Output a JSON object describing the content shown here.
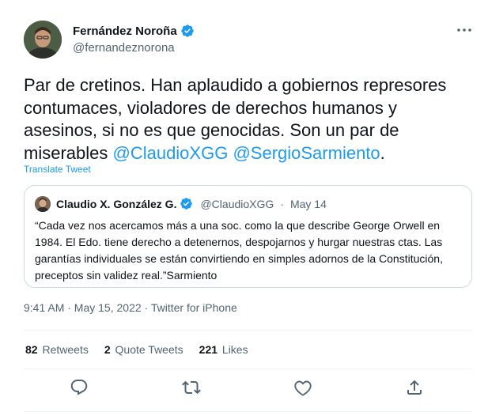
{
  "tweet": {
    "author": {
      "name": "Fernández Noroña",
      "handle": "@fernandeznorona",
      "verified": true
    },
    "text": {
      "body": "Par de cretinos. Han aplaudido a gobiernos represores contumaces, violadores de derechos humanos y asesinos, si no es que genocidas. Son un par de miserables ",
      "mention1": "@ClaudioXGG",
      "space": " ",
      "mention2": "@SergioSarmiento",
      "end": "."
    },
    "translate_label": "Translate Tweet",
    "quote": {
      "author": {
        "name": "Claudio X. González G.",
        "handle": "@ClaudioXGG",
        "verified": true
      },
      "separator": "·",
      "date": "May 14",
      "text": "“Cada vez nos acercamos más a una soc. como la que describe George Orwell en 1984. El Edo. tiene derecho a detenernos, despojarnos y hurgar nuestras ctas. Las garantías individuales se están convirtiendo en simples adornos de la Constitución, preceptos sin validez real.”Sarmiento"
    },
    "meta": "9:41 AM · May 15, 2022 · Twitter for iPhone",
    "stats": {
      "retweets": {
        "count": "82",
        "label": "Retweets"
      },
      "quote_tweets": {
        "count": "2",
        "label": "Quote Tweets"
      },
      "likes": {
        "count": "221",
        "label": "Likes"
      }
    },
    "icons": {
      "more": "more-icon",
      "reply": "reply-icon",
      "retweet": "retweet-icon",
      "like": "like-icon",
      "share": "share-icon",
      "verified": "verified-badge-icon"
    },
    "colors": {
      "accent": "#1d9bf0",
      "text": "#0f1419",
      "secondary": "#536471",
      "border": "#cfd9de"
    }
  }
}
